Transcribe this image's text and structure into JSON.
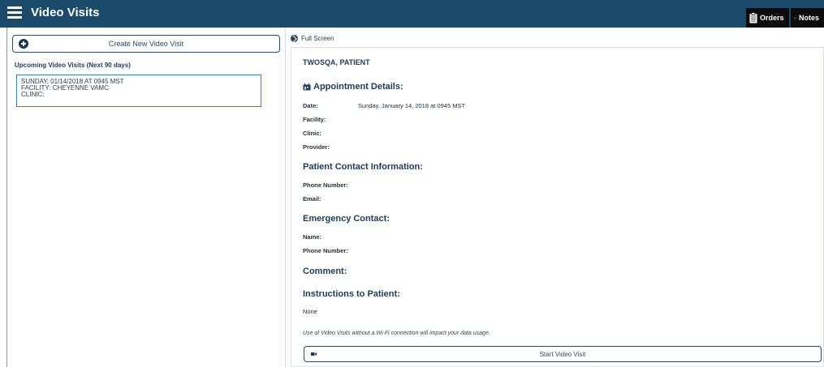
{
  "header": {
    "title": "Video Visits",
    "menu_icon": "hamburger-menu-icon",
    "buttons": [
      {
        "label": "Orders",
        "icon": "clipboard-icon"
      },
      {
        "label": "Notes",
        "icon": "pencil-icon"
      }
    ],
    "colors": {
      "bar": "#1c4a6b",
      "button": "#0c0c0c"
    }
  },
  "left": {
    "create_label": "Create New Video Visit",
    "create_icon": "plus-circle-icon",
    "upcoming_heading": "Upcoming Video Visits (Next 90 days)",
    "visits": [
      {
        "line1": "SUNDAY, 01/14/2018 AT 0945 MST",
        "line2": "FACILITY: CHEYENNE VAMC",
        "line3": "CLINIC:"
      }
    ]
  },
  "right": {
    "fullscreen_label": "Full Screen",
    "fullscreen_icon": "arrow-circle-icon",
    "patient_name": "TWOSQA, PATIENT",
    "appointment": {
      "heading": "Appointment Details:",
      "icon": "calendar-icon",
      "date_label": "Date:",
      "date_value": "Sunday, January 14, 2018 at 0945 MST",
      "facility_label": "Facility:",
      "clinic_label": "Clinic:",
      "provider_label": "Provider:"
    },
    "patient_contact": {
      "heading": "Patient Contact Information:",
      "phone_label": "Phone Number:",
      "email_label": "Email:"
    },
    "emergency_contact": {
      "heading": "Emergency Contact:",
      "name_label": "Name:",
      "phone_label": "Phone Number:"
    },
    "comment_heading": "Comment:",
    "instructions_heading": "Instructions to Patient:",
    "instructions_value": "None",
    "data_usage_note": "Use of Video Visits without a Wi-Fi connection will impact your data usage.",
    "start_label": "Start Video Visit",
    "start_icon": "video-camera-icon"
  }
}
